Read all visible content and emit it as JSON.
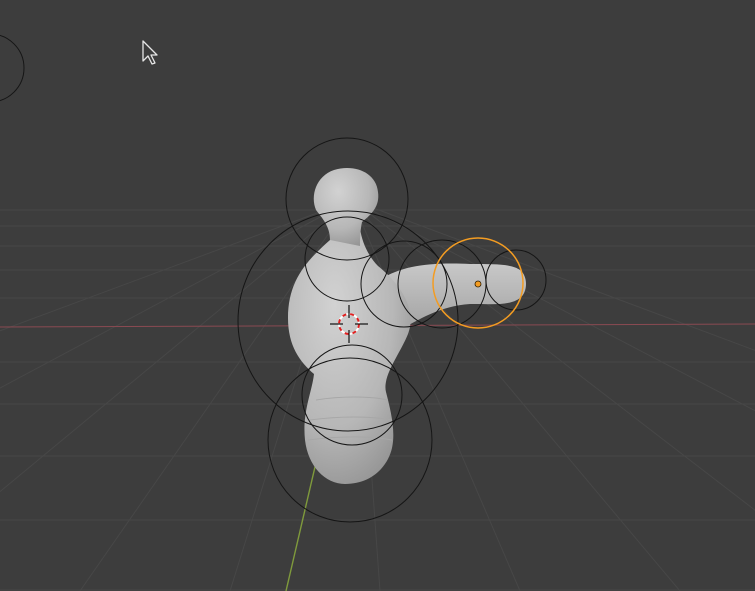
{
  "viewport": {
    "background": "#3d3d3d",
    "grid_color": "#474747",
    "x_axis_color": "#8a4a52",
    "y_axis_color": "#7f9a3c",
    "selection_color": "#f39c22",
    "cursor_icon": "arrow-cursor-icon",
    "origin_icon": "3d-cursor-icon"
  },
  "scene": {
    "object": "skin-modifier-mesh",
    "selected_vertex": "arm-tip-vertex",
    "skin_radius_circles": 11
  }
}
